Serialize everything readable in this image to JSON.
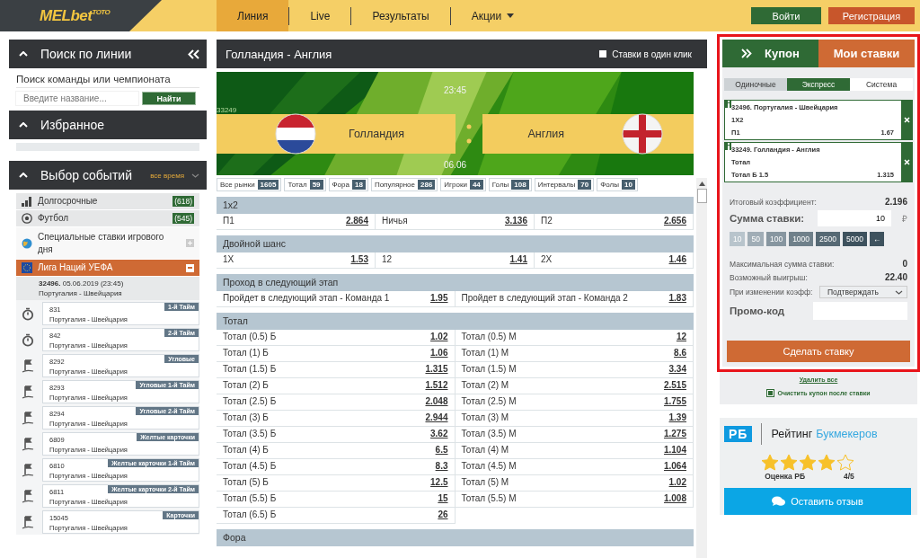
{
  "header": {
    "logo": {
      "main": "MELbet",
      "sup": "TOTO"
    },
    "nav": [
      {
        "label": "Линия",
        "selected": true,
        "dropdown": false
      },
      {
        "label": "Live",
        "selected": false,
        "dropdown": false
      },
      {
        "label": "Результаты",
        "selected": false,
        "dropdown": false
      },
      {
        "label": "Акции",
        "selected": false,
        "dropdown": true
      }
    ],
    "login": "Войти",
    "register": "Регистрация"
  },
  "search_panel": {
    "title": "Поиск по линии",
    "hint": "Поиск команды или чемпионата",
    "placeholder": "Введите название...",
    "button": "Найти"
  },
  "favorites": {
    "title": "Избранное"
  },
  "events": {
    "title": "Выбор событий",
    "period": "все время",
    "items": [
      {
        "kind": "category",
        "label": "Долгосрочные",
        "count": "(618)"
      },
      {
        "kind": "category",
        "label": "Футбол",
        "count": "(545)"
      },
      {
        "kind": "special",
        "label": "Специальные ставки игрового дня",
        "expanded": false
      },
      {
        "kind": "league",
        "label": "Лига Наций УЕФА",
        "expanded": true
      }
    ],
    "match": {
      "head": "**32496.** 05.06.2019 (23:45)",
      "teams": "Португалия - Швейцария"
    },
    "sub_events": [
      {
        "kind": "timer",
        "id": "831",
        "teams": "Португалия - Швейцария",
        "tag": "1-й Тайм"
      },
      {
        "kind": "timer",
        "id": "842",
        "teams": "Португалия - Швейцария",
        "tag": "2-й Тайм"
      },
      {
        "kind": "flag",
        "id": "8292",
        "teams": "Португалия - Швейцария",
        "tag": "Угловые"
      },
      {
        "kind": "flag",
        "id": "8293",
        "teams": "Португалия - Швейцария",
        "tag": "Угловые 1-й Тайм"
      },
      {
        "kind": "flag",
        "id": "8294",
        "teams": "Португалия - Швейцария",
        "tag": "Угловые 2-й Тайм"
      },
      {
        "kind": "flag",
        "id": "6809",
        "teams": "Португалия - Швейцария",
        "tag": "Желтые карточки"
      },
      {
        "kind": "flag",
        "id": "6810",
        "teams": "Португалия - Швейцария",
        "tag": "Желтые карточки 1-й Тайм"
      },
      {
        "kind": "flag",
        "id": "6811",
        "teams": "Португалия - Швейцария",
        "tag": "Желтые карточки 2-й Тайм"
      },
      {
        "kind": "flag",
        "id": "15045",
        "teams": "Португалия - Швейцария",
        "tag": "Карточки"
      }
    ]
  },
  "match": {
    "title": "Голландия - Англия",
    "one_click": {
      "label": "Ставки в один клик",
      "checked": false
    },
    "banner": {
      "time": "23:45",
      "date": "06.06",
      "id": "33249",
      "home": "Голландия",
      "away": "Англия"
    },
    "market_tabs": [
      {
        "label": "Все рынки",
        "count": "1605"
      },
      {
        "label": "Тотал",
        "count": "59"
      },
      {
        "label": "Фора",
        "count": "18"
      },
      {
        "label": "Популярное",
        "count": "286"
      },
      {
        "label": "Игроки",
        "count": "44"
      },
      {
        "label": "Голы",
        "count": "108"
      },
      {
        "label": "Интервалы",
        "count": "70"
      },
      {
        "label": "Фолы",
        "count": "10"
      }
    ],
    "sections": [
      {
        "title": "1x2",
        "rows": [
          [
            {
              "label": "П1",
              "odd": "2.864"
            },
            {
              "label": "Ничья",
              "odd": "3.136"
            },
            {
              "label": "П2",
              "odd": "2.656"
            }
          ]
        ]
      },
      {
        "title": "Двойной шанс",
        "rows": [
          [
            {
              "label": "1X",
              "odd": "1.53"
            },
            {
              "label": "12",
              "odd": "1.41"
            },
            {
              "label": "2X",
              "odd": "1.46"
            }
          ]
        ]
      },
      {
        "title": "Проход в следующий этап",
        "rows": [
          [
            {
              "label": "Пройдет в следующий этап - Команда 1",
              "odd": "1.95"
            },
            {
              "label": "Пройдет в следующий этап - Команда 2",
              "odd": "1.83"
            }
          ]
        ]
      },
      {
        "title": "Тотал",
        "rows": [
          [
            {
              "label": "Тотал (0.5) Б",
              "odd": "1.02"
            },
            {
              "label": "Тотал (0.5) М",
              "odd": "12"
            }
          ],
          [
            {
              "label": "Тотал (1) Б",
              "odd": "1.06"
            },
            {
              "label": "Тотал (1) М",
              "odd": "8.6"
            }
          ],
          [
            {
              "label": "Тотал (1.5) Б",
              "odd": "1.315"
            },
            {
              "label": "Тотал (1.5) М",
              "odd": "3.34"
            }
          ],
          [
            {
              "label": "Тотал (2) Б",
              "odd": "1.512"
            },
            {
              "label": "Тотал (2) М",
              "odd": "2.515"
            }
          ],
          [
            {
              "label": "Тотал (2.5) Б",
              "odd": "2.048"
            },
            {
              "label": "Тотал (2.5) М",
              "odd": "1.755"
            }
          ],
          [
            {
              "label": "Тотал (3) Б",
              "odd": "2.944"
            },
            {
              "label": "Тотал (3) М",
              "odd": "1.39"
            }
          ],
          [
            {
              "label": "Тотал (3.5) Б",
              "odd": "3.62"
            },
            {
              "label": "Тотал (3.5) М",
              "odd": "1.275"
            }
          ],
          [
            {
              "label": "Тотал (4) Б",
              "odd": "6.5"
            },
            {
              "label": "Тотал (4) М",
              "odd": "1.104"
            }
          ],
          [
            {
              "label": "Тотал (4.5) Б",
              "odd": "8.3"
            },
            {
              "label": "Тотал (4.5) М",
              "odd": "1.064"
            }
          ],
          [
            {
              "label": "Тотал (5) Б",
              "odd": "12.5"
            },
            {
              "label": "Тотал (5) М",
              "odd": "1.02"
            }
          ],
          [
            {
              "label": "Тотал (5.5) Б",
              "odd": "15"
            },
            {
              "label": "Тотал (5.5) М",
              "odd": "1.008"
            }
          ],
          [
            {
              "label": "Тотал (6.5) Б",
              "odd": "26"
            }
          ]
        ]
      },
      {
        "title": "Фора"
      }
    ]
  },
  "coupon": {
    "tabs": [
      {
        "label": "Купон",
        "selected": true
      },
      {
        "label": "Мои ставки",
        "selected": false
      }
    ],
    "types": [
      {
        "label": "Одиночные",
        "selected": false
      },
      {
        "label": "Экспресс",
        "selected": true
      },
      {
        "label": "Система",
        "selected": false
      }
    ],
    "bets": [
      {
        "event": "32496. Португалия - Швейцария",
        "market": "1X2",
        "pick": "П1",
        "odd": "1.67"
      },
      {
        "event": "33249. Голландия - Англия",
        "market": "Тотал",
        "pick": "Тотал Б 1.5",
        "odd": "1.315"
      }
    ],
    "total_label": "Итоговый коэффициент:",
    "total_value": "2.196",
    "stake_label": "Сумма ставки:",
    "stake_value": "10",
    "currency": "₽",
    "amounts": [
      "10",
      "50",
      "100",
      "1000",
      "2500",
      "5000"
    ],
    "backspace": "←",
    "max_label": "Максимальная сумма ставки:",
    "max_value": "0",
    "win_label": "Возможный выигрыш:",
    "win_value": "22.40",
    "change_label": "При изменении коэфф:",
    "change_value": "Подтверждать",
    "promo_label": "Промо-код",
    "submit": "Сделать ставку",
    "delete_all": "Удалить все",
    "clear": {
      "label": "Очистить купон после ставки",
      "checked": true
    }
  },
  "rating": {
    "logo": "РБ",
    "title": "Рейтинг",
    "title_accent": "Букмекеров",
    "stars": 4,
    "label": "Оценка РБ",
    "score": "4/5",
    "button": "Оставить отзыв"
  }
}
